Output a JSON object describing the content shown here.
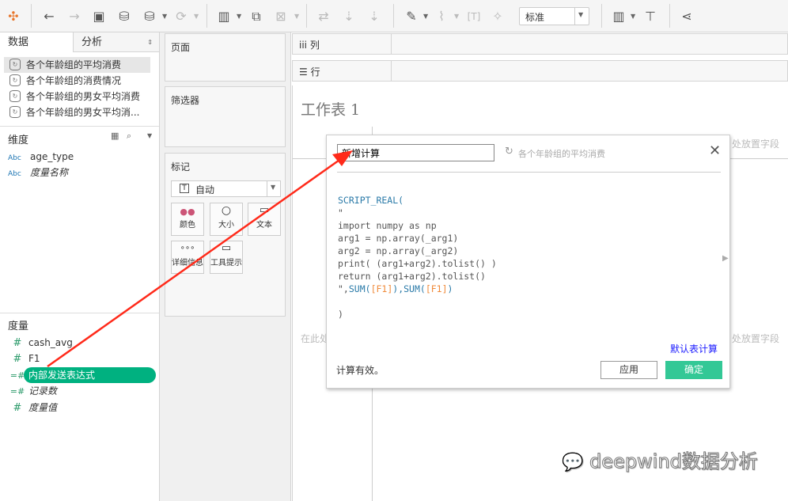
{
  "toolbar": {
    "view_mode": "标准",
    "icons": [
      "tableau-logo-icon",
      "back-icon",
      "forward-icon",
      "save-icon",
      "new-datasource-icon",
      "pause-icon",
      "refresh-icon",
      "new-worksheet-icon",
      "duplicate-icon",
      "clear-icon",
      "swap-icon",
      "sort-asc-icon",
      "sort-desc-icon",
      "highlight-icon",
      "attach-icon",
      "text-label-icon",
      "pin-icon",
      "show-me-icon",
      "presentation-icon",
      "share-icon"
    ]
  },
  "left": {
    "tabs": [
      "数据",
      "分析"
    ],
    "datasources": [
      "各个年龄组的平均消费",
      "各个年龄组的消费情况",
      "各个年龄组的男女平均消费",
      "各个年龄组的男女平均消..."
    ],
    "dimensions_title": "维度",
    "dimensions": [
      {
        "type": "Abc",
        "name": "age_type"
      },
      {
        "type": "Abc",
        "name": "度量名称"
      }
    ],
    "measures_title": "度量",
    "measures": [
      {
        "name": "cash_avg"
      },
      {
        "name": "F1"
      },
      {
        "name": "内部发送表达式"
      },
      {
        "name": "记录数"
      },
      {
        "name": "度量值"
      }
    ]
  },
  "cards": {
    "pages": "页面",
    "filters": "筛选器",
    "marks": "标记",
    "mark_type": "自动",
    "mark_buttons": [
      "颜色",
      "大小",
      "文本",
      "详细信息",
      "工具提示"
    ]
  },
  "shelves": {
    "columns": "列",
    "rows": "行"
  },
  "canvas": {
    "title": "工作表 1",
    "drop_hint_right": "处放置字段",
    "drop_hint_left": "在此处"
  },
  "dialog": {
    "name": "新增计算",
    "datasource": "各个年龄组的平均消费",
    "default_table_calc": "默认表计算",
    "status": "计算有效。",
    "apply": "应用",
    "ok": "确定",
    "code": {
      "l1": "SCRIPT_REAL(",
      "l2": "\"",
      "l3": "import numpy as np",
      "l4": "arg1 = np.array(_arg1)",
      "l5": "arg2 = np.array(_arg2)",
      "l6": "print( (arg1+arg2).tolist() )",
      "l7": "return (arg1+arg2).tolist()",
      "l8a": "\",",
      "l8b": "SUM(",
      "l8c": "[F1]",
      "l8d": "),",
      "l8e": "SUM(",
      "l8f": "[F1]",
      "l8g": ")",
      "l9": ")"
    }
  },
  "watermark": "deepwind数据分析",
  "colors": {
    "accent": "#00b180",
    "ok_button": "#33c896",
    "link": "#1a1aff",
    "arrow": "#ff2a1a"
  }
}
